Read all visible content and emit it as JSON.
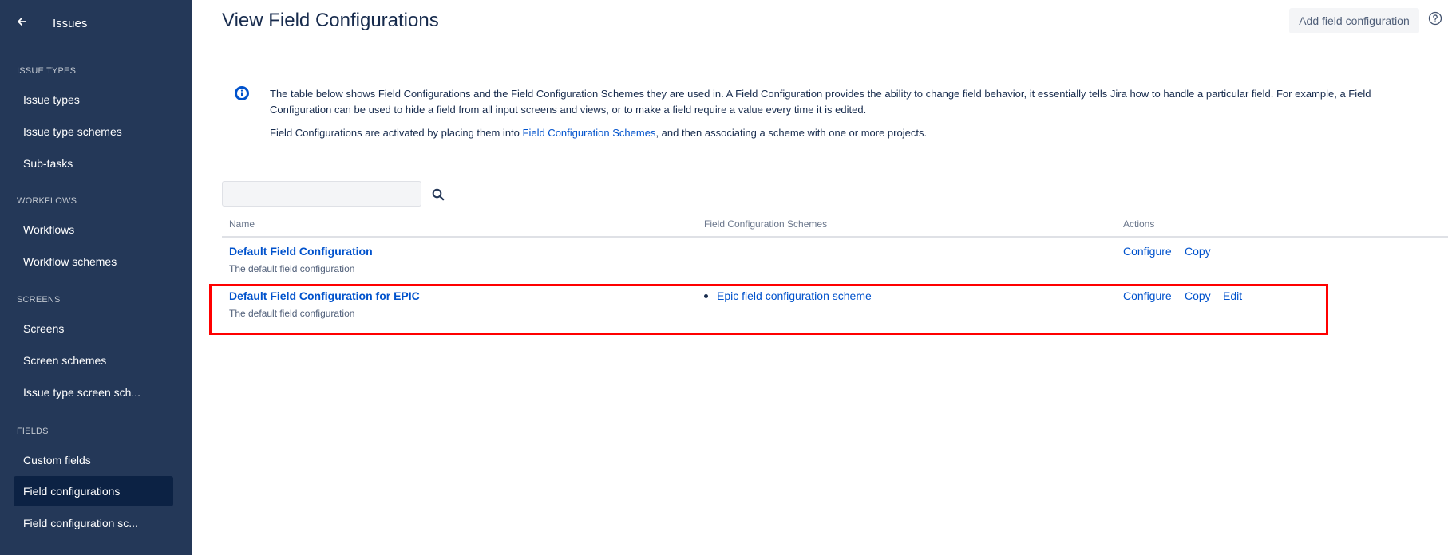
{
  "sidebar": {
    "back_label": "Issues",
    "sections": [
      {
        "title": "ISSUE TYPES",
        "items": [
          "Issue types",
          "Issue type schemes",
          "Sub-tasks"
        ]
      },
      {
        "title": "WORKFLOWS",
        "items": [
          "Workflows",
          "Workflow schemes"
        ]
      },
      {
        "title": "SCREENS",
        "items": [
          "Screens",
          "Screen schemes",
          "Issue type screen sch..."
        ]
      },
      {
        "title": "FIELDS",
        "items": [
          "Custom fields",
          "Field configurations",
          "Field configuration sc..."
        ]
      }
    ],
    "active_item": "Field configurations",
    "colors": {
      "background": "#243858",
      "active": "#0c2244"
    }
  },
  "header": {
    "title": "View Field Configurations",
    "add_button": "Add field configuration",
    "help_icon": "help-icon"
  },
  "info": {
    "icon": "info-icon",
    "paragraph1": "The table below shows Field Configurations and the Field Configuration Schemes they are used in. A Field Configuration provides the ability to change field behavior, it essentially tells Jira how to handle a particular field. For example, a Field Configuration can be used to hide a field from all input screens and views, or to make a field require a value every time it is edited.",
    "paragraph2_before": "Field Configurations are activated by placing them into ",
    "paragraph2_link": "Field Configuration Schemes",
    "paragraph2_after": ", and then associating a scheme with one or more projects."
  },
  "search": {
    "value": "",
    "placeholder": "",
    "icon": "search-icon"
  },
  "table": {
    "columns": [
      "Name",
      "Field Configuration Schemes",
      "Actions"
    ],
    "rows": [
      {
        "name": "Default Field Configuration",
        "description": "The default field configuration",
        "schemes": [],
        "actions": [
          "Configure",
          "Copy"
        ]
      },
      {
        "name": "Default Field Configuration for EPIC",
        "description": "The default field configuration",
        "schemes": [
          "Epic field configuration scheme"
        ],
        "actions": [
          "Configure",
          "Copy",
          "Edit"
        ]
      }
    ]
  },
  "colors": {
    "link": "#0052cc",
    "highlight": "#ff0000"
  }
}
